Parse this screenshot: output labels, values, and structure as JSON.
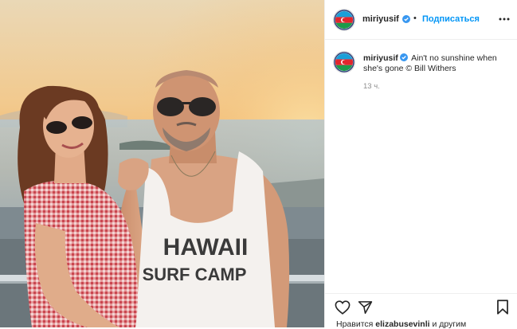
{
  "post": {
    "image_alt": "",
    "shirt_text_line1": "HAWAII",
    "shirt_text_line2": "SURF CAMP"
  },
  "header": {
    "username": "miriyusif",
    "dot": "•",
    "follow_label": "Подписаться",
    "verified_icon": "verified-badge-icon",
    "more_icon": "more-options-icon"
  },
  "caption": {
    "username": "miriyusif",
    "text": "Ain't no sunshine when she's gone © Bill Withers",
    "time": "13 ч."
  },
  "actions": {
    "like_icon": "heart-icon",
    "share_icon": "send-icon",
    "save_icon": "bookmark-icon"
  },
  "likes": {
    "prefix": "Нравится",
    "user": "elizabusevinli",
    "suffix": "и другим"
  },
  "colors": {
    "accent": "#0095f6",
    "verified": "#3897f0",
    "text": "#262626",
    "muted": "#8e8e8e",
    "border": "#efefef"
  }
}
